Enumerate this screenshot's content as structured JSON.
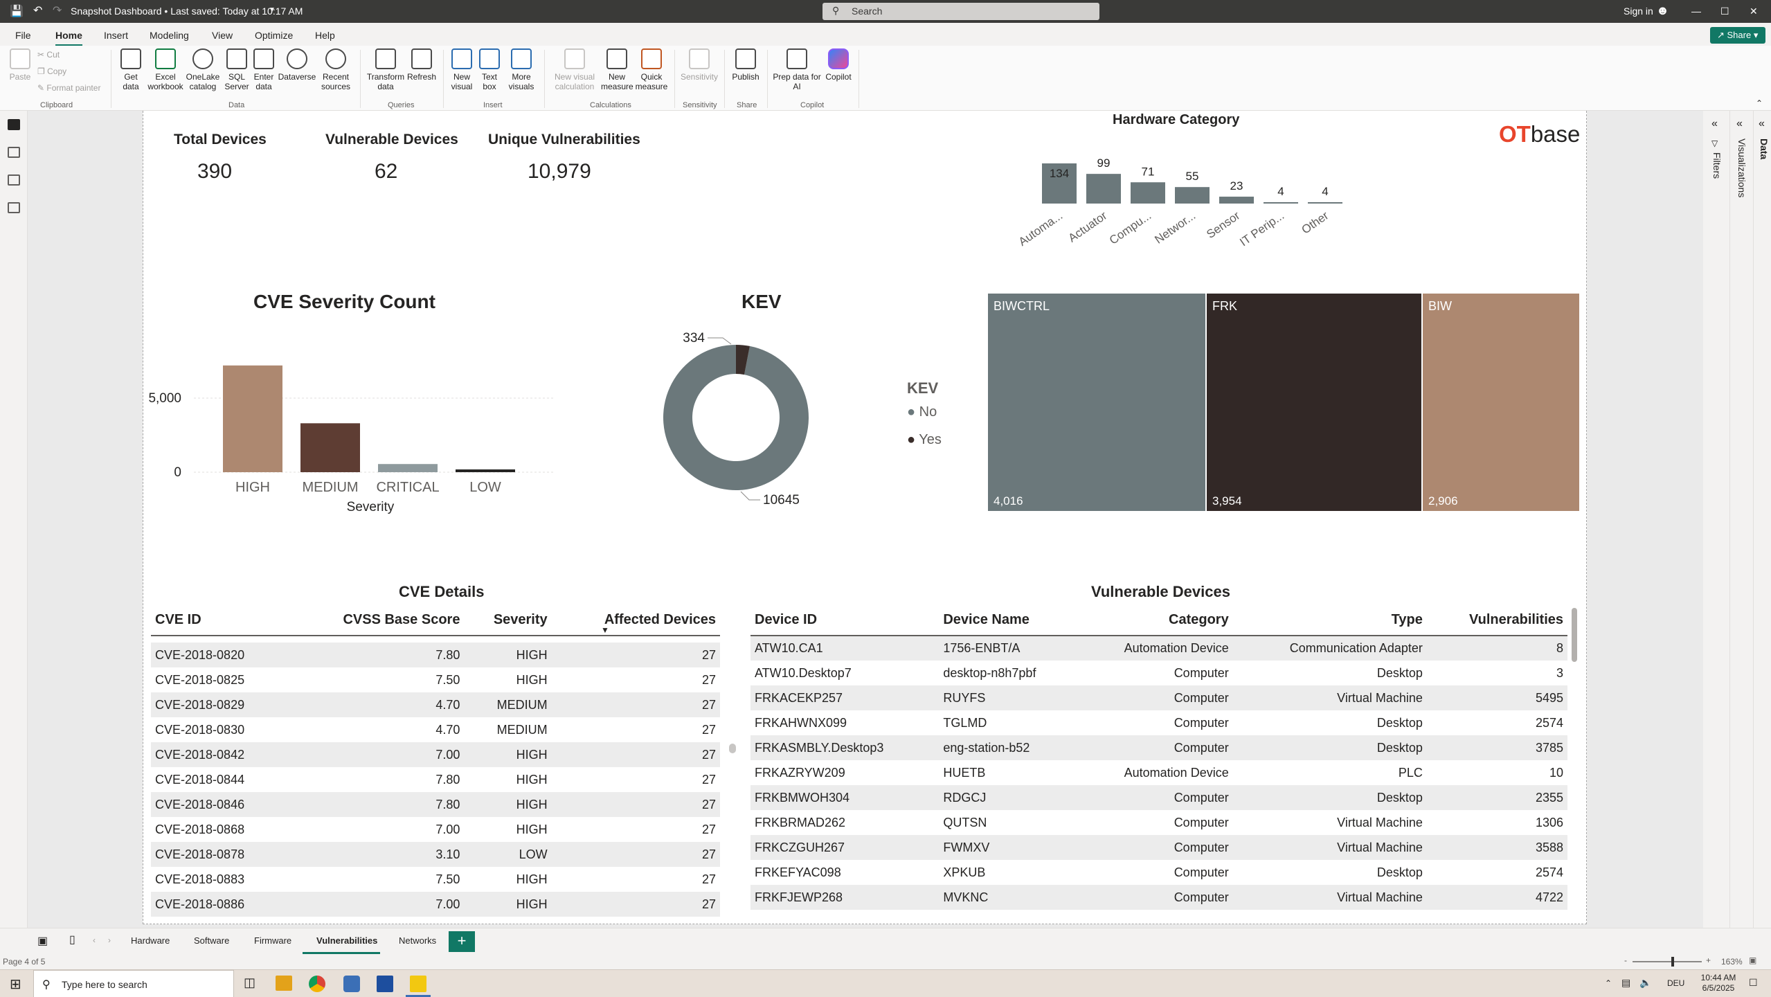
{
  "window": {
    "title": "Snapshot Dashboard • Last saved: Today at 10:17 AM",
    "search_placeholder": "Search",
    "signin": "Sign in"
  },
  "ribbon_tabs": [
    "File",
    "Home",
    "Insert",
    "Modeling",
    "View",
    "Optimize",
    "Help"
  ],
  "share_label": "Share",
  "ribbon": {
    "paste": "Paste",
    "cut": "Cut",
    "copy": "Copy",
    "format_painter": "Format painter",
    "get_data": "Get data",
    "excel": "Excel workbook",
    "onelake": "OneLake catalog",
    "sql": "SQL Server",
    "enter_data": "Enter data",
    "dataverse": "Dataverse",
    "recent": "Recent sources",
    "transform": "Transform data",
    "refresh": "Refresh",
    "new_visual": "New visual",
    "text_box": "Text box",
    "more_visuals": "More visuals",
    "new_visual_calc": "New visual calculation",
    "new_measure": "New measure",
    "quick_measure": "Quick measure",
    "sensitivity": "Sensitivity",
    "publish": "Publish",
    "prep_data": "Prep data for AI",
    "copilot": "Copilot",
    "groups": {
      "clipboard": "Clipboard",
      "data": "Data",
      "queries": "Queries",
      "insert": "Insert",
      "calculations": "Calculations",
      "sensitivity": "Sensitivity",
      "share": "Share",
      "copilot": "Copilot"
    }
  },
  "panes": {
    "filters": "Filters",
    "visualizations": "Visualizations",
    "data": "Data"
  },
  "kpis": {
    "total_devices_label": "Total Devices",
    "total_devices_value": "390",
    "vulnerable_devices_label": "Vulnerable Devices",
    "vulnerable_devices_value": "62",
    "unique_vulns_label": "Unique Vulnerabilities",
    "unique_vulns_value": "10,979"
  },
  "logo": {
    "ot": "OT",
    "base": "base"
  },
  "chart_data": [
    {
      "type": "bar",
      "title": "Hardware Category",
      "categories": [
        "Automa...",
        "Actuator",
        "Compu...",
        "Networ...",
        "Sensor",
        "IT Perip...",
        "Other"
      ],
      "values": [
        134,
        99,
        71,
        55,
        23,
        4,
        4
      ],
      "color": "#6b787b"
    },
    {
      "type": "bar",
      "title": "CVE Severity Count",
      "xlabel": "Severity",
      "categories": [
        "HIGH",
        "MEDIUM",
        "CRITICAL",
        "LOW"
      ],
      "values": [
        7200,
        3300,
        550,
        180
      ],
      "colors": [
        "#ad8870",
        "#5e3d33",
        "#8e9a9d",
        "#252423"
      ],
      "yticks": [
        "5,000",
        "0"
      ],
      "ylim": [
        0,
        8500
      ]
    },
    {
      "type": "pie",
      "title": "KEV",
      "legend_title": "KEV",
      "slices": [
        {
          "name": "No",
          "value": 10645,
          "color": "#6b787b"
        },
        {
          "name": "Yes",
          "value": 334,
          "color": "#3a2d2a"
        }
      ]
    },
    {
      "type": "treemap",
      "cells": [
        {
          "name": "BIWCTRL",
          "value": "4,016",
          "color": "#6b787b"
        },
        {
          "name": "FRK",
          "value": "3,954",
          "color": "#322826"
        },
        {
          "name": "BIW",
          "value": "2,906",
          "color": "#ad8870"
        }
      ]
    }
  ],
  "cve_table": {
    "title": "CVE Details",
    "headers": [
      "CVE ID",
      "CVSS Base Score",
      "Severity",
      "Affected Devices"
    ],
    "rows": [
      [
        "CVE-2018-0820",
        "7.80",
        "HIGH",
        "27"
      ],
      [
        "CVE-2018-0825",
        "7.50",
        "HIGH",
        "27"
      ],
      [
        "CVE-2018-0829",
        "4.70",
        "MEDIUM",
        "27"
      ],
      [
        "CVE-2018-0830",
        "4.70",
        "MEDIUM",
        "27"
      ],
      [
        "CVE-2018-0842",
        "7.00",
        "HIGH",
        "27"
      ],
      [
        "CVE-2018-0844",
        "7.80",
        "HIGH",
        "27"
      ],
      [
        "CVE-2018-0846",
        "7.80",
        "HIGH",
        "27"
      ],
      [
        "CVE-2018-0868",
        "7.00",
        "HIGH",
        "27"
      ],
      [
        "CVE-2018-0878",
        "3.10",
        "LOW",
        "27"
      ],
      [
        "CVE-2018-0883",
        "7.50",
        "HIGH",
        "27"
      ],
      [
        "CVE-2018-0886",
        "7.00",
        "HIGH",
        "27"
      ]
    ]
  },
  "device_table": {
    "title": "Vulnerable Devices",
    "headers": [
      "Device ID",
      "Device Name",
      "Category",
      "Type",
      "Vulnerabilities"
    ],
    "rows": [
      [
        "ATW10.CA1",
        "1756-ENBT/A",
        "Automation Device",
        "Communication Adapter",
        "8"
      ],
      [
        "ATW10.Desktop7",
        "desktop-n8h7pbf",
        "Computer",
        "Desktop",
        "3"
      ],
      [
        "FRKACEKP257",
        "RUYFS",
        "Computer",
        "Virtual Machine",
        "5495"
      ],
      [
        "FRKAHWNX099",
        "TGLMD",
        "Computer",
        "Desktop",
        "2574"
      ],
      [
        "FRKASMBLY.Desktop3",
        "eng-station-b52",
        "Computer",
        "Desktop",
        "3785"
      ],
      [
        "FRKAZRYW209",
        "HUETB",
        "Automation Device",
        "PLC",
        "10"
      ],
      [
        "FRKBMWOH304",
        "RDGCJ",
        "Computer",
        "Desktop",
        "2355"
      ],
      [
        "FRKBRMAD262",
        "QUTSN",
        "Computer",
        "Virtual Machine",
        "1306"
      ],
      [
        "FRKCZGUH267",
        "FWMXV",
        "Computer",
        "Virtual Machine",
        "3588"
      ],
      [
        "FRKEFYAC098",
        "XPKUB",
        "Computer",
        "Desktop",
        "2574"
      ],
      [
        "FRKFJEWP268",
        "MVKNC",
        "Computer",
        "Virtual Machine",
        "4722"
      ]
    ]
  },
  "page_tabs": [
    "Hardware",
    "Software",
    "Firmware",
    "Vulnerabilities",
    "Networks"
  ],
  "status": {
    "page": "Page 4 of 5",
    "zoom": "163%"
  },
  "taskbar": {
    "search": "Type here to search",
    "lang": "DEU",
    "time": "10:44 AM",
    "date": "6/5/2025"
  }
}
